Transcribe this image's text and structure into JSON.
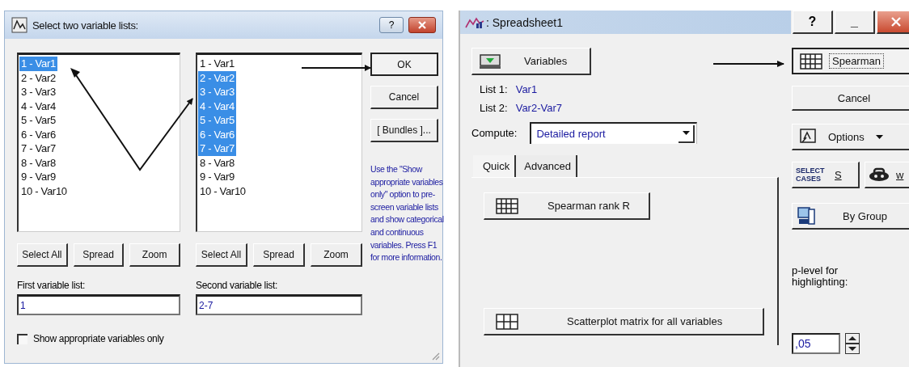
{
  "select_dialog": {
    "title": "Select two variable lists:",
    "title_buttons": [
      "?"
    ],
    "lists": [
      {
        "items": [
          {
            "label": "1 - Var1",
            "selected": true
          },
          {
            "label": "2 - Var2",
            "selected": false
          },
          {
            "label": "3 - Var3",
            "selected": false
          },
          {
            "label": "4 - Var4",
            "selected": false
          },
          {
            "label": "5 - Var5",
            "selected": false
          },
          {
            "label": "6 - Var6",
            "selected": false
          },
          {
            "label": "7 - Var7",
            "selected": false
          },
          {
            "label": "8 - Var8",
            "selected": false
          },
          {
            "label": "9 - Var9",
            "selected": false
          },
          {
            "label": "10 - Var10",
            "selected": false
          }
        ],
        "buttons": [
          "Select All",
          "Spread",
          "Zoom"
        ],
        "field_label": "First variable list:",
        "field_value": "1"
      },
      {
        "items": [
          {
            "label": "1 - Var1",
            "selected": false
          },
          {
            "label": "2 - Var2",
            "selected": true
          },
          {
            "label": "3 - Var3",
            "selected": true
          },
          {
            "label": "4 - Var4",
            "selected": true
          },
          {
            "label": "5 - Var5",
            "selected": true
          },
          {
            "label": "6 - Var6",
            "selected": true
          },
          {
            "label": "7 - Var7",
            "selected": true
          },
          {
            "label": "8 - Var8",
            "selected": false
          },
          {
            "label": "9 - Var9",
            "selected": false
          },
          {
            "label": "10 - Var10",
            "selected": false
          }
        ],
        "buttons": [
          "Select All",
          "Spread",
          "Zoom"
        ],
        "field_label": "Second variable list:",
        "field_value": "2-7"
      }
    ],
    "buttons": [
      {
        "label": "OK",
        "kind": "default"
      },
      {
        "label": "Cancel",
        "kind": "plain"
      },
      {
        "label": "[ Bundles ]...",
        "kind": "plain"
      }
    ],
    "help_text": "Use the \"Show appropriate variables only\" option to pre-screen variable lists and show categorical and continuous variables. Press F1 for more information.",
    "checkbox": {
      "label": "Show appropriate variables only",
      "checked": false
    }
  },
  "spreadsheet_dialog": {
    "title": ": Spreadsheet1",
    "title_buttons": [
      "?",
      "_"
    ],
    "variables_button": "Variables",
    "lists": [
      {
        "label": "List 1:",
        "value": "Var1"
      },
      {
        "label": "List 2:",
        "value": "Var2-Var7"
      }
    ],
    "compute": {
      "label": "Compute:",
      "value": "Detailed report"
    },
    "tabs": [
      {
        "label": "Quick",
        "selected": true
      },
      {
        "label": "Advanced",
        "selected": false
      }
    ],
    "tab_buttons": [
      "Spearman rank R",
      "Scatterplot matrix for all variables"
    ],
    "side_buttons": [
      {
        "label": "Spearman",
        "kind": "default"
      },
      {
        "label": "Cancel",
        "kind": "plain"
      },
      {
        "label": "Options",
        "kind": "menu"
      }
    ],
    "select_cases": {
      "icon_text": "SELECT CASES",
      "label": "S"
    },
    "weight_button": "w",
    "by_group_button": "By Group",
    "p_level": {
      "label": "p-level for highlighting:",
      "value": ",05"
    }
  }
}
